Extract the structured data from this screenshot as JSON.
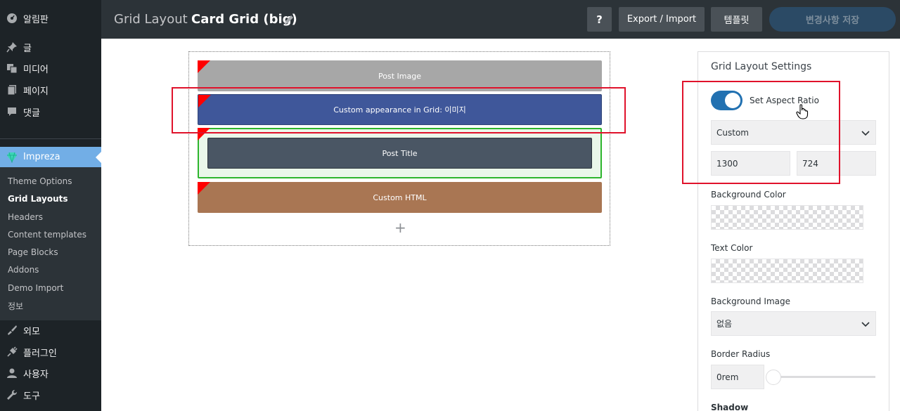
{
  "sidebar": {
    "items_top": [
      {
        "label": "알림판",
        "icon": "dashboard-icon"
      },
      {
        "label": "글",
        "icon": "pin-icon"
      },
      {
        "label": "미디어",
        "icon": "media-icon"
      },
      {
        "label": "페이지",
        "icon": "page-icon"
      },
      {
        "label": "댓글",
        "icon": "comment-icon"
      }
    ],
    "active": {
      "label": "Impreza",
      "icon": "impreza-gem-icon"
    },
    "submenu": [
      "Theme Options",
      "Grid Layouts",
      "Headers",
      "Content templates",
      "Page Blocks",
      "Addons",
      "Demo Import",
      "정보"
    ],
    "submenu_current": "Grid Layouts",
    "items_bottom": [
      {
        "label": "외모",
        "icon": "brush-icon"
      },
      {
        "label": "플러그인",
        "icon": "plugin-icon"
      },
      {
        "label": "사용자",
        "icon": "user-icon"
      },
      {
        "label": "도구",
        "icon": "wrench-icon"
      }
    ]
  },
  "topbar": {
    "section_label": "Grid Layout",
    "layout_title": "Card Grid (big)",
    "help_label": "?",
    "export_label": "Export / Import",
    "template_label": "템플릿",
    "save_label": "변경사항 저장"
  },
  "canvas": {
    "elements": [
      {
        "label": "Post Image",
        "color": "#a7a7a7"
      },
      {
        "label": "Custom appearance in Grid: 이미지",
        "color": "#3f579a"
      },
      {
        "label": "Post Title",
        "color": "#4a5664"
      },
      {
        "label": "Custom HTML",
        "color": "#a97653"
      }
    ],
    "add_label": "+"
  },
  "settings": {
    "title": "Grid Layout Settings",
    "aspect_label": "Set Aspect Ratio",
    "aspect_enabled": true,
    "ratio_mode": "Custom",
    "width": "1300",
    "height": "724",
    "bg_color_label": "Background Color",
    "text_color_label": "Text Color",
    "bg_image_label": "Background Image",
    "bg_image_value": "없음",
    "border_radius_label": "Border Radius",
    "border_radius_value": "0rem",
    "shadow_label": "Shadow"
  },
  "colors": {
    "accent": "#2271b1",
    "highlight_red": "#e0122b",
    "highlight_green": "#2db52d"
  }
}
